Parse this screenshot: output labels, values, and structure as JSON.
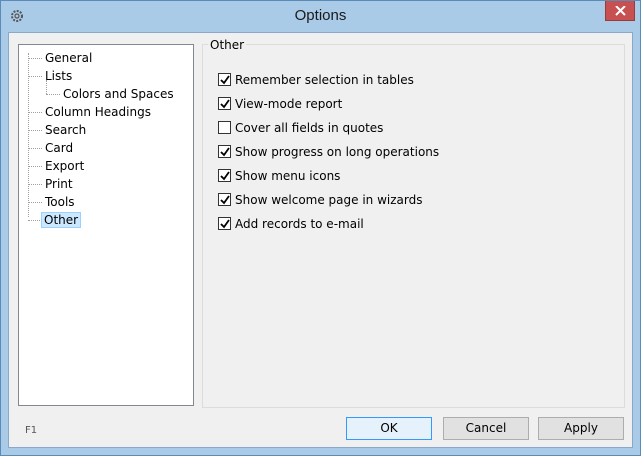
{
  "window": {
    "title": "Options"
  },
  "tree": {
    "items": [
      {
        "label": "General"
      },
      {
        "label": "Lists"
      },
      {
        "label": "Colors and Spaces"
      },
      {
        "label": "Column Headings"
      },
      {
        "label": "Search"
      },
      {
        "label": "Card"
      },
      {
        "label": "Export"
      },
      {
        "label": "Print"
      },
      {
        "label": "Tools"
      },
      {
        "label": "Other"
      }
    ],
    "selected": "Other"
  },
  "group": {
    "title": "Other"
  },
  "options": [
    {
      "label": "Remember selection in tables",
      "checked": true
    },
    {
      "label": "View-mode report",
      "checked": true
    },
    {
      "label": "Cover all fields in quotes",
      "checked": false
    },
    {
      "label": "Show progress on long operations",
      "checked": true
    },
    {
      "label": "Show menu icons",
      "checked": true
    },
    {
      "label": "Show welcome page in wizards",
      "checked": true
    },
    {
      "label": "Add records to e-mail",
      "checked": true
    }
  ],
  "footer": {
    "help_key": "F1",
    "ok_label": "OK",
    "cancel_label": "Cancel",
    "apply_label": "Apply"
  },
  "colors": {
    "titlebar": "#a9cbe8",
    "close": "#c75050",
    "selection": "#cce8ff"
  },
  "icons": {
    "app": "gear-icon",
    "close": "close-icon",
    "check": "checkmark-icon"
  }
}
